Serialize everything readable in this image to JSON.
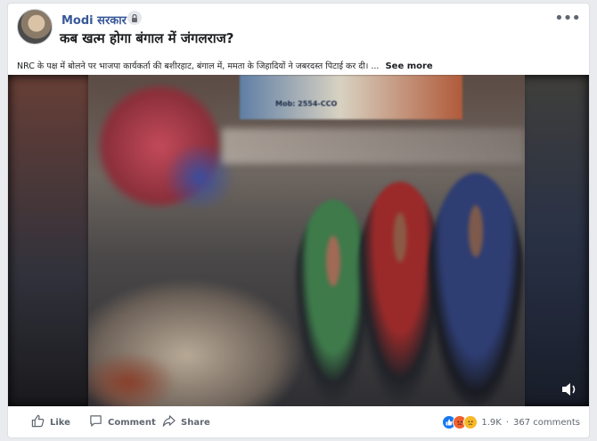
{
  "post": {
    "page_name": "Modi सरकार",
    "headline": "कब खत्म होगा बंगाल में जंगलराज?",
    "caption": "NRC के पक्ष में बोलने पर भाजपा कार्यकर्ता की बशीरहाट, बंगाल में, ममता के जिहादियों ने जबरदस्त पिटाई कर दी। ...",
    "see_more": "See more",
    "video_sign_text": "Mob: 2554-CCO"
  },
  "actions": {
    "like": "Like",
    "comment": "Comment",
    "share": "Share"
  },
  "stats": {
    "reaction_count": "1.9K",
    "separator": "·",
    "comment_count": "367 comments"
  },
  "icons": {
    "more": "more-options-icon",
    "lock": "globe-lock-icon",
    "volume": "volume-icon",
    "like": "thumbs-up-icon",
    "comment": "comment-icon",
    "share": "share-icon"
  },
  "colors": {
    "link": "#385898",
    "like_reaction": "#1877f2",
    "angry_reaction": "#f0602e",
    "sad_reaction": "#f7b928"
  }
}
